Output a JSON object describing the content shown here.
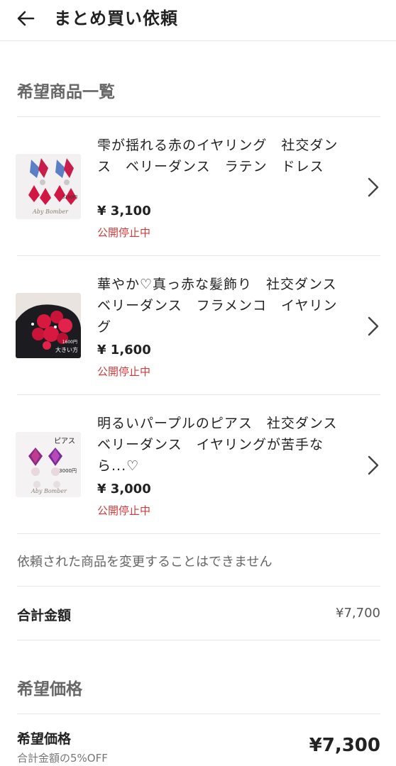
{
  "header": {
    "title": "まとめ買い依頼"
  },
  "list_section": {
    "title": "希望商品一覧"
  },
  "items": [
    {
      "name": "雫が揺れる赤のイヤリング　社交ダンス　ベリーダンス　ラテン　ドレス",
      "price": "¥ 3,100",
      "status": "公開停止中",
      "thumb_label": "3100円",
      "thumb_sub": "Aby Bomber"
    },
    {
      "name": "華やか♡真っ赤な髪飾り　社交ダンス　ベリーダンス　フラメンコ　イヤリング",
      "price": "¥ 1,600",
      "status": "公開停止中",
      "thumb_label": "1600円",
      "thumb_sub": "大きい方"
    },
    {
      "name": "明るいパープルのピアス　社交ダンス　ベリーダンス　イヤリングが苦手なら...♡",
      "price": "¥ 3,000",
      "status": "公開停止中",
      "thumb_tag": "ピアス",
      "thumb_label": "3000円",
      "thumb_sub": "Aby Bomber"
    }
  ],
  "notice": "依頼された商品を変更することはできません",
  "total": {
    "label": "合計金額",
    "value": "¥7,700"
  },
  "desired_section": {
    "title": "希望価格"
  },
  "desired": {
    "label": "希望価格",
    "sub": "合計金額の5%OFF",
    "value": "¥7,300"
  },
  "colors": {
    "status_red": "#d23b3b",
    "divider": "#e6e6e6"
  },
  "icons": {
    "back": "arrow-left-icon",
    "chevron": "chevron-right-icon"
  }
}
